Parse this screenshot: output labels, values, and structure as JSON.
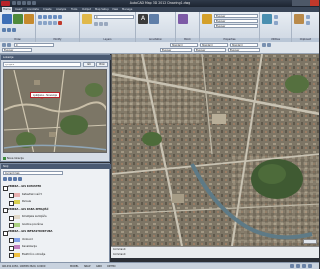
{
  "window": {
    "title": "AutoCAD Map 3D 2012  Drawing1.dwg"
  },
  "ribbon": {
    "tabs": [
      "Home",
      "Insert",
      "Annotate",
      "Create",
      "Analyze",
      "Tools",
      "Output",
      "Map Setup",
      "View",
      "Manage"
    ],
    "groups": [
      "Draw",
      "Modify",
      "Layers",
      "Annotation",
      "Block",
      "Properties",
      "Utilities",
      "Clipboard"
    ],
    "layer_combo": "0",
    "bylayer_1": "ByLayer",
    "bylayer_2": "ByLayer",
    "bylayer_3": "ByLayer",
    "standard_1": "Standard",
    "standard_2": "Standard",
    "standard_3": "Standard"
  },
  "nav_pane": {
    "title": "Lokacije",
    "search_placeholder": "Ljubljana",
    "btn_go": "Išči",
    "btn_clear": "Briši",
    "callout": "Ljubljana - Slovenija",
    "footer": "Nova lokacija"
  },
  "layer_pane": {
    "title": "Sloji",
    "combo": "Current map",
    "rows": [
      {
        "label": "ZBIRKA - GIS KATASTER",
        "group": true,
        "color": ""
      },
      {
        "label": "Katastrski načrt",
        "group": false,
        "color": "#e8b0b0"
      },
      {
        "label": "Parcele",
        "group": false,
        "color": "#d8d050"
      },
      {
        "label": "ZBIRKA - GIS RABA ZEMLJIŠČ",
        "group": true,
        "color": ""
      },
      {
        "label": "Kmetijske zemljišča",
        "group": false,
        "color": "#e0d8c8"
      },
      {
        "label": "Gozdne površine",
        "group": false,
        "color": "#a8d080"
      },
      {
        "label": "ZBIRKA - GIS INFRASTRUKTURA",
        "group": true,
        "color": ""
      },
      {
        "label": "Vodovod",
        "group": false,
        "color": "#80a0e8"
      },
      {
        "label": "Kanalizacija",
        "group": false,
        "color": "#c080c0"
      },
      {
        "label": "Električno omrežje",
        "group": false,
        "color": "#f0c040"
      }
    ]
  },
  "command": {
    "line1": "Command:",
    "line2": "Command:"
  },
  "status": {
    "coords": "461432.1050, 100858.3620, 0.0000",
    "items": [
      "MODEL",
      "SNAP",
      "GRID",
      "ORTHO"
    ]
  }
}
